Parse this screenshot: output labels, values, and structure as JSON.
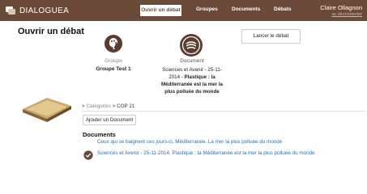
{
  "header": {
    "brand": "DIALOGUEA",
    "brand_icon": "dialoguea-logo-icon",
    "nav": [
      {
        "label": "Ouvrir un débat",
        "active": true
      },
      {
        "label": "Groupes",
        "active": false
      },
      {
        "label": "Documents",
        "active": false
      },
      {
        "label": "Débats",
        "active": false
      }
    ],
    "user_name": "Claire Ollagnon",
    "logout": "se déconnecter"
  },
  "main": {
    "title": "Ouvrir un débat",
    "group": {
      "icon": "palette-icon",
      "label": "Groupe",
      "name": "Groupe Test 1"
    },
    "document": {
      "icon": "document-emblem-icon",
      "label": "Document",
      "desc_plain": "Sciences et Avenir - 25-11-2014 - ",
      "desc_bold": "Plastique : la Méditerranée est la mer la plus polluée du monde"
    },
    "launch_button": "Lancer le débat",
    "breadcrumb": {
      "prefix": ">",
      "categories": "Categories",
      "separator": ">",
      "current": "COP 21"
    },
    "add_document_button": "Ajouter un Document",
    "documents_title": "Documents",
    "documents": [
      {
        "text": "Ceux qui se baignent ces jours-ci, Méditerranée. La mer la plus polluée du monde",
        "checked": false
      },
      {
        "text": "Sciences et Avenir - 25-11-2014, Plastique : la Méditerranée est la mer la plus polluée du monde",
        "checked": true
      }
    ]
  },
  "colors": {
    "header_bg": "#6b4a39",
    "link": "#2a6fb8",
    "check": "#6b4a39"
  }
}
